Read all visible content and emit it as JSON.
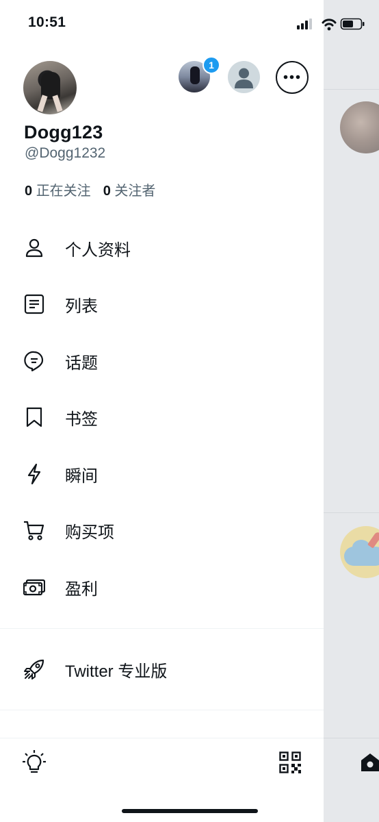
{
  "status_bar": {
    "time": "10:51"
  },
  "profile": {
    "display_name": "Dogg123",
    "handle": "@Dogg1232",
    "following_count": "0",
    "following_label": "正在关注",
    "followers_count": "0",
    "followers_label": "关注者"
  },
  "account_switcher": {
    "badge_count": "1"
  },
  "menu": {
    "items": [
      {
        "label": "个人资料",
        "icon": "person-icon"
      },
      {
        "label": "列表",
        "icon": "list-icon"
      },
      {
        "label": "话题",
        "icon": "topics-icon"
      },
      {
        "label": "书签",
        "icon": "bookmark-icon"
      },
      {
        "label": "瞬间",
        "icon": "lightning-icon"
      },
      {
        "label": "购买项",
        "icon": "cart-icon"
      },
      {
        "label": "盈利",
        "icon": "money-icon"
      }
    ],
    "professional": {
      "label": "Twitter 专业版",
      "icon": "rocket-icon"
    }
  },
  "bottom": {
    "left_icon": "lightbulb-icon",
    "right_icon": "qr-code-icon"
  },
  "colors": {
    "accent": "#1d9bf0",
    "text": "#0f1419",
    "secondary_text": "#536471",
    "divider": "#eff3f4"
  }
}
